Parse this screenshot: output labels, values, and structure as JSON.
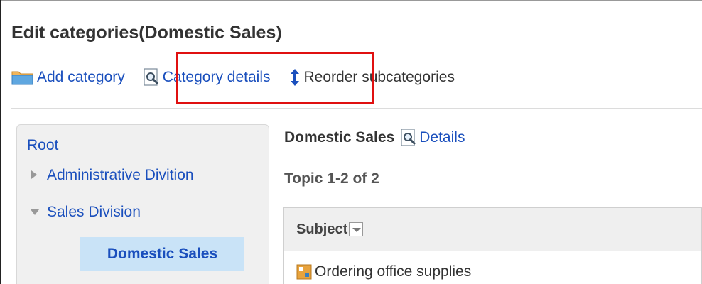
{
  "page": {
    "title": "Edit categories(Domestic Sales)"
  },
  "toolbar": {
    "add_category": "Add category",
    "category_details": "Category details",
    "reorder_subcategories": "Reorder subcategories"
  },
  "tree": {
    "root": "Root",
    "items": [
      {
        "label": "Administrative Divition",
        "state": "collapsed"
      },
      {
        "label": "Sales Division",
        "state": "expanded"
      }
    ],
    "selected": "Domestic Sales"
  },
  "main": {
    "folder_name": "Domestic Sales",
    "details_link": "Details",
    "topic_count": "Topic 1-2 of 2",
    "table": {
      "column_subject": "Subject",
      "rows": [
        {
          "subject": "Ordering office supplies"
        }
      ]
    }
  },
  "colors": {
    "link": "#1a4fbd",
    "highlight": "#e01010",
    "selected_bg": "#c9e3f7"
  }
}
